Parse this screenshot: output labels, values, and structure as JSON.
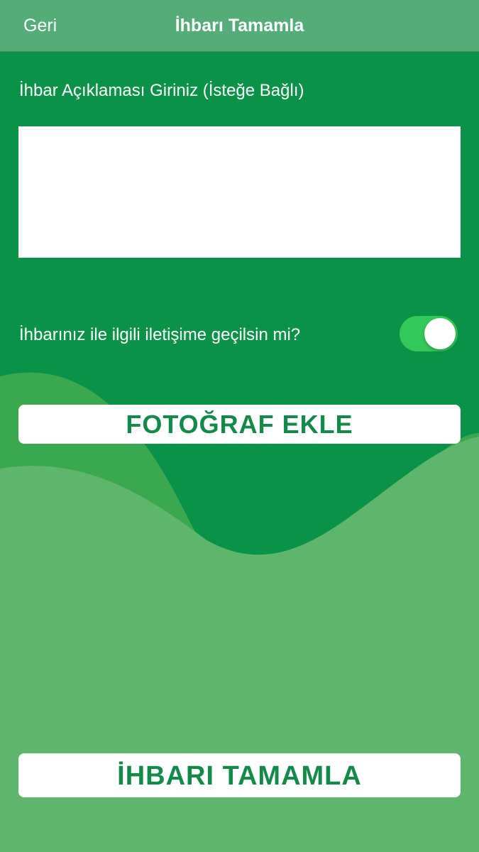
{
  "nav": {
    "back_label": "Geri",
    "title": "İhbarı Tamamla"
  },
  "description": {
    "label": "İhbar Açıklaması Giriniz (İsteğe Bağlı)",
    "value": "",
    "placeholder": ""
  },
  "contact": {
    "label": "İhbarınız ile ilgili iletişime geçilsin mi?",
    "enabled": true
  },
  "buttons": {
    "add_photo_label": "FOTOĞRAF EKLE",
    "submit_label": "İHBARI TAMAMLA"
  },
  "colors": {
    "background_dark": "#0a9248",
    "wave_mid": "#3ba84f",
    "wave_light": "#5db66b",
    "nav_bar": "#54ad78",
    "toggle_on": "#34c759",
    "button_text": "#138a4a"
  }
}
